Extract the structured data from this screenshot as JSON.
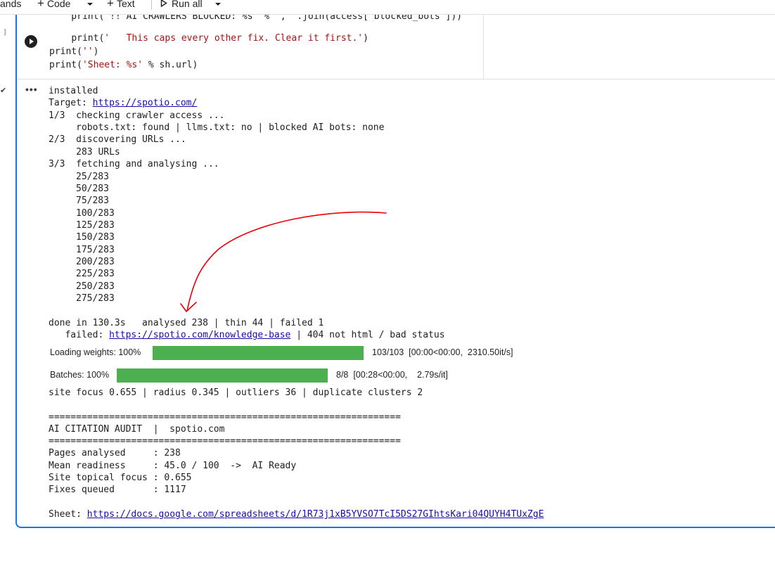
{
  "toolbar": {
    "commands_label": "ands",
    "code_label": "Code",
    "text_label": "Text",
    "runall_label": "Run all"
  },
  "cell": {
    "exec_bracket": "]",
    "code_lines": [
      "    print('!! AI CRAWLERS BLOCKED: %s' % ', '.join(access['blocked_bots']))",
      "    print('   This caps every other fix. Clear it first.')",
      "print('')",
      "print('Sheet: %s' % sh.url)"
    ]
  },
  "output": {
    "installed": "installed",
    "target_prefix": "Target: ",
    "target_url": "https://spotio.com/",
    "step1": "1/3  checking crawler access ...",
    "step1_detail": "     robots.txt: found | llms.txt: no | blocked AI bots: none",
    "step2": "2/3  discovering URLs ...",
    "step2_detail": "     283 URLs",
    "step3": "3/3  fetching and analysing ...",
    "progress_lines": [
      "25/283",
      "50/283",
      "75/283",
      "100/283",
      "125/283",
      "150/283",
      "175/283",
      "200/283",
      "225/283",
      "250/283",
      "275/283"
    ],
    "done_line": "done in 130.3s   analysed 238 | thin 44 | failed 1",
    "failed_prefix": "   failed: ",
    "failed_url": "https://spotio.com/knowledge-base",
    "failed_suffix": " | 404 not html / bad status",
    "loading": {
      "label": "Loading weights: 100%",
      "progress": 1.0,
      "stats": "103/103  [00:00<00:00,  2310.50it/s]"
    },
    "batches": {
      "label": "Batches: 100%",
      "progress": 1.0,
      "stats": "8/8  [00:28<00:00,    2.79s/it]"
    },
    "focus_line": "site focus 0.655 | radius 0.345 | outliers 36 | duplicate clusters 2",
    "rule": "================================================================",
    "audit_title": "AI CITATION AUDIT  |  spotio.com",
    "summary": [
      "Pages analysed     : 238",
      "Mean readiness     : 45.0 / 100  ->  AI Ready",
      "Site topical focus : 0.655",
      "Fixes queued       : 1117"
    ],
    "sheet_prefix": "Sheet: ",
    "sheet_url": "https://docs.google.com/spreadsheets/d/1R73j1xB5YVSO7TcI5DS27GIhtsKari04QUYH4TUxZgE"
  },
  "colors": {
    "accent": "#1a73e8",
    "progress": "#4caf50",
    "annotation": "#e8000b",
    "link": "#1a0dab"
  }
}
